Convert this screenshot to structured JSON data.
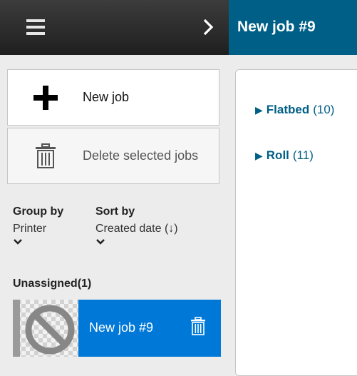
{
  "header": {
    "menu_icon": "hamburger-menu-icon",
    "expand_icon": "chevron-right-icon",
    "job_title": "New job #9"
  },
  "actions": {
    "new_job_label": "New job",
    "new_job_icon": "plus-icon",
    "delete_label": "Delete selected jobs",
    "delete_icon": "trash-icon"
  },
  "controls": {
    "group_by": {
      "title": "Group by",
      "value": "Printer"
    },
    "sort_by": {
      "title": "Sort by",
      "value": "Created date (↓)"
    }
  },
  "jobs_section": {
    "title": "Unassigned(1)",
    "jobs": [
      {
        "name": "New job #9",
        "thumbnail_icon": "no-preview-icon",
        "delete_icon": "trash-icon"
      }
    ]
  },
  "categories": [
    {
      "name": "Flatbed",
      "count": "(10)"
    },
    {
      "name": "Roll",
      "count": "(11)"
    }
  ],
  "colors": {
    "header_accent": "#005f86",
    "selected_job": "#0078d7",
    "link": "#005f86"
  }
}
